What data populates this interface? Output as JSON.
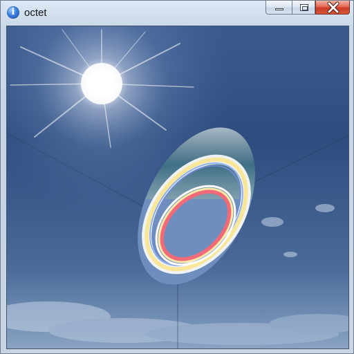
{
  "window": {
    "title": "octet",
    "icon": "info-icon",
    "controls": [
      "minimize",
      "maximize",
      "close"
    ]
  },
  "scene": {
    "elements": [
      "sky",
      "sun",
      "floor-grid-lines",
      "elliptical-portal",
      "rainbow-rings"
    ],
    "colors": {
      "sky_top": "#2b4a7d",
      "sky_bottom": "#7f97b7",
      "sun": "#ffffff",
      "ring_red": "#f06a7a",
      "ring_yellow": "#f8e79a",
      "ring_blue": "#6f88d0"
    }
  }
}
